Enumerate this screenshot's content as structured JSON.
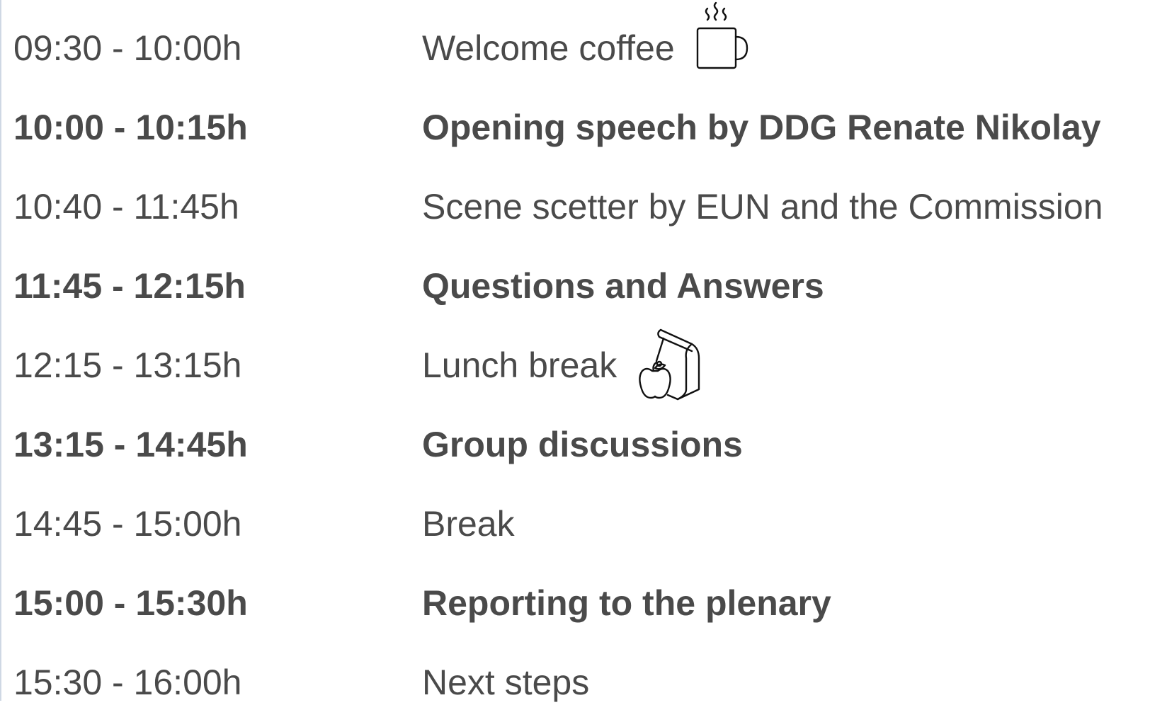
{
  "agenda": {
    "items": [
      {
        "time": "09:30 - 10:00h",
        "title": "Welcome coffee",
        "bold": false,
        "icon": "coffee-cup-icon"
      },
      {
        "time": "10:00 - 10:15h",
        "title": "Opening speech by DDG Renate Nikolay",
        "bold": true
      },
      {
        "time": "10:40 - 11:45h",
        "title": "Scene scetter by EUN and the Commission",
        "bold": false
      },
      {
        "time": "11:45 - 12:15h",
        "title": "Questions and Answers",
        "bold": true
      },
      {
        "time": "12:15 - 13:15h",
        "title": "Lunch break",
        "bold": false,
        "icon": "lunch-bag-apple-icon"
      },
      {
        "time": "13:15 - 14:45h",
        "title": "Group discussions",
        "bold": true
      },
      {
        "time": "14:45 - 15:00h",
        "title": "Break",
        "bold": false
      },
      {
        "time": "15:00 - 15:30h",
        "title": "Reporting to the plenary",
        "bold": true
      },
      {
        "time": "15:30 - 16:00h",
        "title": "Next steps",
        "bold": false
      }
    ]
  },
  "colors": {
    "text": "#4a4a4a",
    "icon_stroke": "#111111",
    "left_edge": "#cfd8e4"
  }
}
